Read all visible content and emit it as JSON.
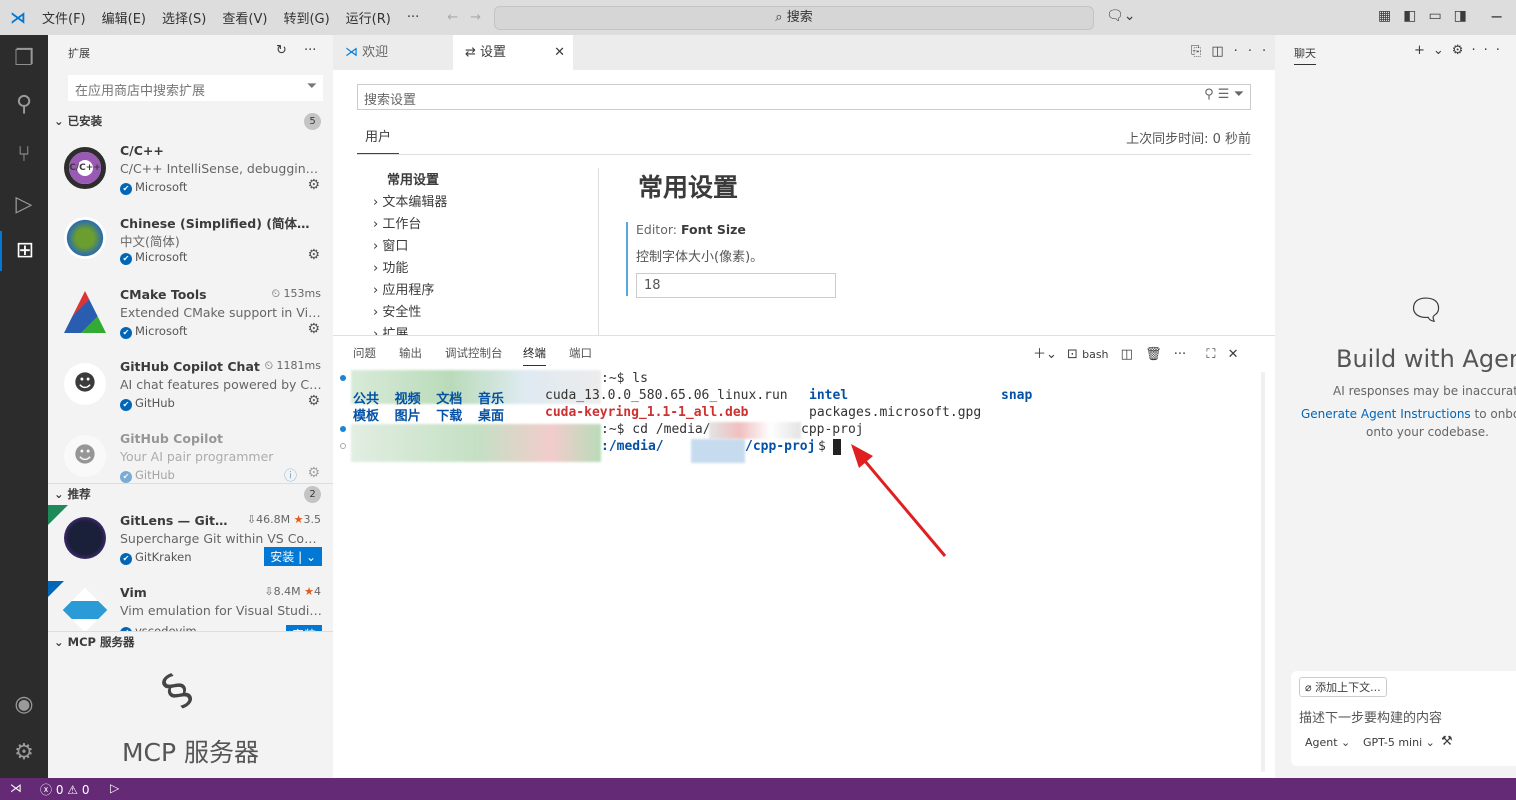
{
  "titlebar": {
    "menus": [
      "文件(F)",
      "编辑(E)",
      "选择(S)",
      "查看(V)",
      "转到(G)",
      "运行(R)",
      "···"
    ],
    "search": "搜索"
  },
  "sidebar": {
    "title": "扩展",
    "search_placeholder": "在应用商店中搜索扩展",
    "installed": {
      "label": "已安装",
      "count": "5",
      "items": [
        {
          "name": "C/C++",
          "desc": "C/C++ IntelliSense, debugging, a...",
          "publisher": "Microsoft",
          "logo_text": "C/C++"
        },
        {
          "name": "Chinese (Simplified) (简体中文)...",
          "desc": "中文(简体)",
          "publisher": "Microsoft"
        },
        {
          "name": "CMake Tools",
          "desc": "Extended CMake support in Visu...",
          "publisher": "Microsoft",
          "time": "153ms"
        },
        {
          "name": "GitHub Copilot Chat",
          "desc": "AI chat features powered by Co...",
          "publisher": "GitHub",
          "time": "1181ms"
        },
        {
          "name": "GitHub Copilot",
          "desc": "Your AI pair programmer",
          "publisher": "GitHub"
        }
      ]
    },
    "recommended": {
      "label": "推荐",
      "count": "2",
      "items": [
        {
          "name": "GitLens — Git s...",
          "desc": "Supercharge Git within VS Code ...",
          "publisher": "GitKraken",
          "downloads": "46.8M",
          "rating": "3.5",
          "install": "安装"
        },
        {
          "name": "Vim",
          "desc": "Vim emulation for Visual Studio ...",
          "publisher": "vscodevim",
          "downloads": "8.4M",
          "rating": "4",
          "install": "安装"
        }
      ]
    },
    "mcp": {
      "label": "MCP 服务器",
      "title": "MCP 服务器"
    }
  },
  "tabs": [
    {
      "label": "欢迎"
    },
    {
      "label": "设置"
    }
  ],
  "settings": {
    "search_placeholder": "搜索设置",
    "scope": "用户",
    "sync": "上次同步时间: 0 秒前",
    "toc": [
      "常用设置",
      "文本编辑器",
      "工作台",
      "窗口",
      "功能",
      "应用程序",
      "安全性",
      "扩展"
    ],
    "heading": "常用设置",
    "setting_prefix": "Editor: ",
    "setting_name": "Font Size",
    "setting_desc": "控制字体大小(像素)。",
    "value": "18"
  },
  "panel": {
    "tabs": [
      "问题",
      "输出",
      "调试控制台",
      "终端",
      "端口"
    ],
    "shell": "bash",
    "lines": {
      "l1": ":~$ ls",
      "dirs1": "公共  视频  文档  音乐",
      "file1": "cuda_13.0.0_580.65.06_linux.run",
      "dir_intel": "intel",
      "dir_snap": "snap",
      "dirs2": "模板  图片  下载  桌面",
      "file2": "cuda-keyring_1.1-1_all.deb",
      "file3": "packages.microsoft.gpg",
      "l3a": ":~$ cd /media/",
      "l3b": "cpp-proj",
      "l4a": ":/media/",
      "l4b": "/cpp-proj",
      "l4c": "$"
    }
  },
  "chat": {
    "title": "聊天",
    "heading": "Build with Agent",
    "disclaimer": "AI responses may be inaccurate.",
    "link": "Generate Agent Instructions",
    "link_rest": " to onboard",
    "line2": "onto your codebase.",
    "add_context": "添加上下文...",
    "input_placeholder": "描述下一步要构建的内容",
    "mode": "Agent",
    "model": "GPT-5 mini"
  },
  "status": {
    "errors": "0",
    "warnings": "0"
  }
}
